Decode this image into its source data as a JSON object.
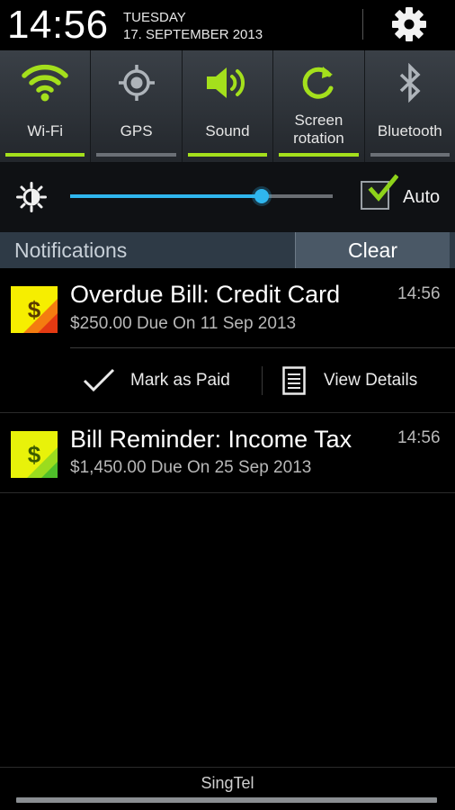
{
  "header": {
    "time": "14:56",
    "day": "TUESDAY",
    "date": "17. SEPTEMBER 2013",
    "settings_icon": "gear-icon"
  },
  "toggles": [
    {
      "label": "Wi-Fi",
      "icon": "wifi-icon",
      "state": "on"
    },
    {
      "label": "GPS",
      "icon": "gps-icon",
      "state": "off"
    },
    {
      "label": "Sound",
      "icon": "sound-icon",
      "state": "on"
    },
    {
      "label_line1": "Screen",
      "label_line2": "rotation",
      "icon": "rotation-icon",
      "state": "on"
    },
    {
      "label": "Bluetooth",
      "icon": "bluetooth-icon",
      "state": "off"
    }
  ],
  "brightness": {
    "icon": "brightness-icon",
    "level": 0.73,
    "auto_checked": true,
    "auto_label": "Auto"
  },
  "notifications": {
    "title": "Notifications",
    "clear_label": "Clear",
    "items": [
      {
        "title": "Overdue Bill: Credit Card",
        "subtitle": "$250.00 Due On 11 Sep 2013",
        "time": "14:56",
        "actions": [
          {
            "label": "Mark as Paid",
            "icon": "check-icon"
          },
          {
            "label": "View Details",
            "icon": "document-icon"
          }
        ]
      },
      {
        "title": "Bill Reminder: Income Tax",
        "subtitle": "$1,450.00 Due On 25 Sep 2013",
        "time": "14:56"
      }
    ]
  },
  "footer": {
    "carrier": "SingTel"
  },
  "colors": {
    "accent_green": "#a4e01c",
    "slider_blue": "#2fb6ee",
    "panel_blue": "#2e3a46"
  }
}
